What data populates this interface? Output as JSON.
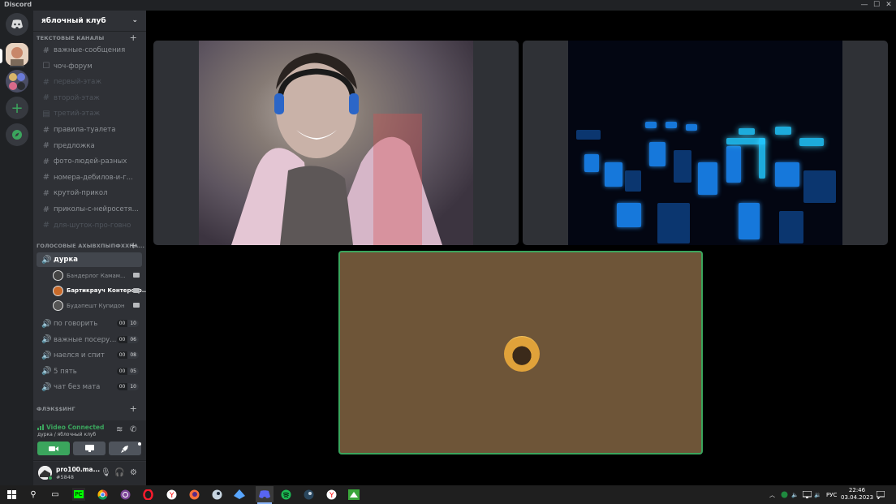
{
  "titlebar": {
    "app": "Discord",
    "min": "—",
    "max": "☐",
    "close": "✕"
  },
  "guild": {
    "name": "яблочный клуб",
    "chevron": "⌄"
  },
  "categories": {
    "text": "ТЕКСТОВЫЕ КАНАЛЫ",
    "voice": "ГОЛОСОВЫЕ АХЫВХПЫПФХХПА...",
    "flex": "ФЛЭК$$ИНГ",
    "plus": "+"
  },
  "text_channels": [
    {
      "name": "важные-сообщения",
      "icon": "#",
      "muted": false
    },
    {
      "name": "чоч-форум",
      "icon": "☐",
      "muted": false
    },
    {
      "name": "первый-этаж",
      "icon": "#",
      "muted": true
    },
    {
      "name": "второй-этаж",
      "icon": "#",
      "muted": true
    },
    {
      "name": "третий-этаж",
      "icon": "▤",
      "muted": true
    },
    {
      "name": "правила-туалета",
      "icon": "#",
      "muted": false
    },
    {
      "name": "предложка",
      "icon": "#",
      "muted": false
    },
    {
      "name": "фото-людей-разных",
      "icon": "#",
      "muted": false
    },
    {
      "name": "номера-дебилов-и-г...",
      "icon": "#",
      "muted": false
    },
    {
      "name": "крутой-прикол",
      "icon": "#",
      "muted": false
    },
    {
      "name": "приколы-с-нейросетя...",
      "icon": "#",
      "muted": false
    },
    {
      "name": "для-шуток-про-говно",
      "icon": "#",
      "muted": true
    }
  ],
  "voice_active": {
    "name": "дурка",
    "icon": "🔊"
  },
  "voice_users": [
    {
      "name": "Бандерлог Камам...",
      "bright": false
    },
    {
      "name": "Бартикрауч Контерстр...",
      "bright": true
    },
    {
      "name": "Будапешт Купидон",
      "bright": false
    }
  ],
  "voice_channels": [
    {
      "name": "по говорить",
      "a": "00",
      "b": "10"
    },
    {
      "name": "важные посеру...",
      "a": "00",
      "b": "06"
    },
    {
      "name": "наелся и спит",
      "a": "00",
      "b": "08"
    },
    {
      "name": "5 пять",
      "a": "00",
      "b": "05"
    },
    {
      "name": "чат без мата",
      "a": "00",
      "b": "10"
    }
  ],
  "rtc": {
    "status": "Video Connected",
    "location": "дурка / яблочный клуб"
  },
  "user": {
    "name": "pro100.ma...",
    "tag": "#5848"
  },
  "taskbar": {
    "lang": "РУС",
    "time": "22:46",
    "date": "03.04.2023"
  },
  "colors": {
    "accent_green": "#3ba55d",
    "sidebar": "#2f3136",
    "rail": "#202225"
  }
}
